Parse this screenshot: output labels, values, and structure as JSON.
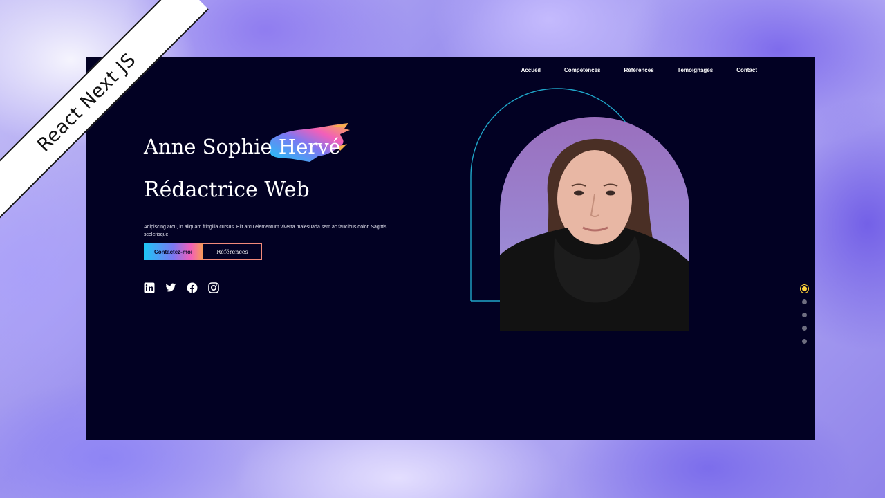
{
  "ribbon": {
    "label": "React Next JS"
  },
  "nav": [
    {
      "label": "Accueil"
    },
    {
      "label": "Compétences"
    },
    {
      "label": "Références"
    },
    {
      "label": "Témoignages"
    },
    {
      "label": "Contact"
    }
  ],
  "hero": {
    "first_names": "Anne Sophie ",
    "last_name": "Hervé",
    "role": "Rédactrice Web",
    "description": "Adipiscing arcu, in aliquam fringilla cursus. Elit arcu elementum viverra malesuada sem ac faucibus dolor. Sagittis scelerisque.",
    "contact_button": "Contactez-moi",
    "references_button": "Références"
  },
  "social": [
    "linkedin-icon",
    "twitter-icon",
    "facebook-icon",
    "instagram-icon"
  ],
  "slider": {
    "total": 5,
    "active": 1
  },
  "colors": {
    "page_bg": "#020123",
    "active_dot": "#ffd23a",
    "arch_outline": "#1fa6c9",
    "gradient": [
      "#1cc7f5",
      "#7b78f2",
      "#f25fb9",
      "#f79a5a"
    ]
  }
}
